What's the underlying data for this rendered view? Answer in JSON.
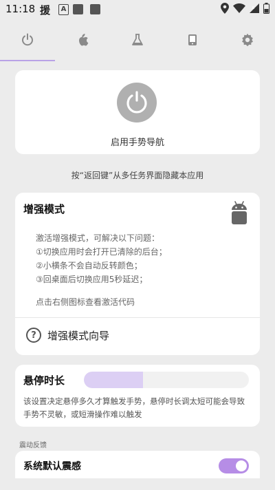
{
  "status_bar": {
    "time": "11:18",
    "app_glyph": "援",
    "icons": [
      "text-a-icon",
      "square-icon",
      "square-icon",
      "location-icon",
      "wifi-icon",
      "signal-icon",
      "battery-icon"
    ]
  },
  "nav": {
    "tabs": [
      {
        "name": "power-tab",
        "icon": "power-icon",
        "active": true
      },
      {
        "name": "apple-tab",
        "icon": "apple-icon"
      },
      {
        "name": "flask-tab",
        "icon": "flask-icon"
      },
      {
        "name": "phone-tab",
        "icon": "phone-icon"
      },
      {
        "name": "settings-tab",
        "icon": "gear-icon"
      }
    ],
    "accent_color": "#b9a2e6"
  },
  "power_card": {
    "label": "启用手势导航"
  },
  "hint": "按“返回键”从多任务界面隐藏本应用",
  "enhanced_mode": {
    "title": "增强模式",
    "lines": [
      "激活增强模式，可解决以下问题：",
      "①切换应用时会打开已清除的后台；",
      "②小横条不会自动反转颜色；",
      "③回桌面后切换应用5秒延迟；"
    ],
    "tip": "点击右侧图标查看激活代码",
    "wizard_label": "增强模式向导"
  },
  "hover_time": {
    "title": "悬停时长",
    "slider_fraction": 0.36,
    "description": "该设置决定悬停多久才算触发手势，悬停时长调太短可能会导致手势不灵敏，或短滑操作难以触发"
  },
  "vibration": {
    "section_title": "震动反馈",
    "system_default_label": "系统默认震感",
    "system_default_on": true,
    "toggle_color": "#b68de6"
  }
}
